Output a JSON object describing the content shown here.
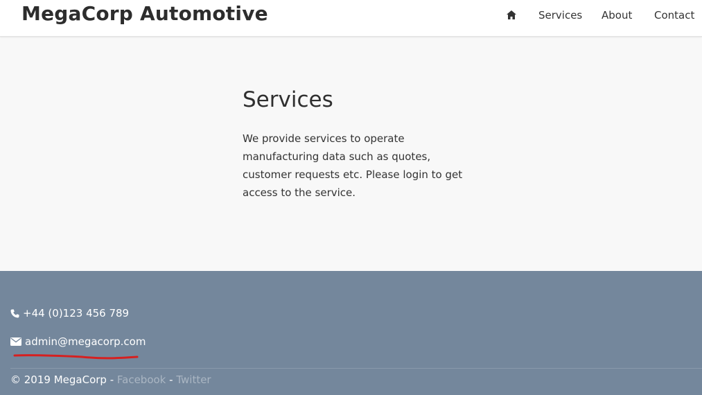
{
  "header": {
    "brand": "MegaCorp Automotive",
    "nav": {
      "home_icon": "home-icon",
      "services": "Services",
      "about": "About",
      "contact": "Contact"
    }
  },
  "main": {
    "title": "Services",
    "paragraph": "We provide services to operate manufacturing data such as quotes, customer requests etc. Please login to get access to the service."
  },
  "footer": {
    "phone_icon": "phone-icon",
    "phone": "+44 (0)123 456 789",
    "email_icon": "envelope-icon",
    "email": "admin@megacorp.com",
    "copyright": "© 2019 MegaCorp - ",
    "separator": " - ",
    "facebook": "Facebook",
    "twitter": "Twitter"
  },
  "colors": {
    "footer_bg": "#74879c",
    "annotation": "#d62020",
    "link": "#aab6c3"
  }
}
